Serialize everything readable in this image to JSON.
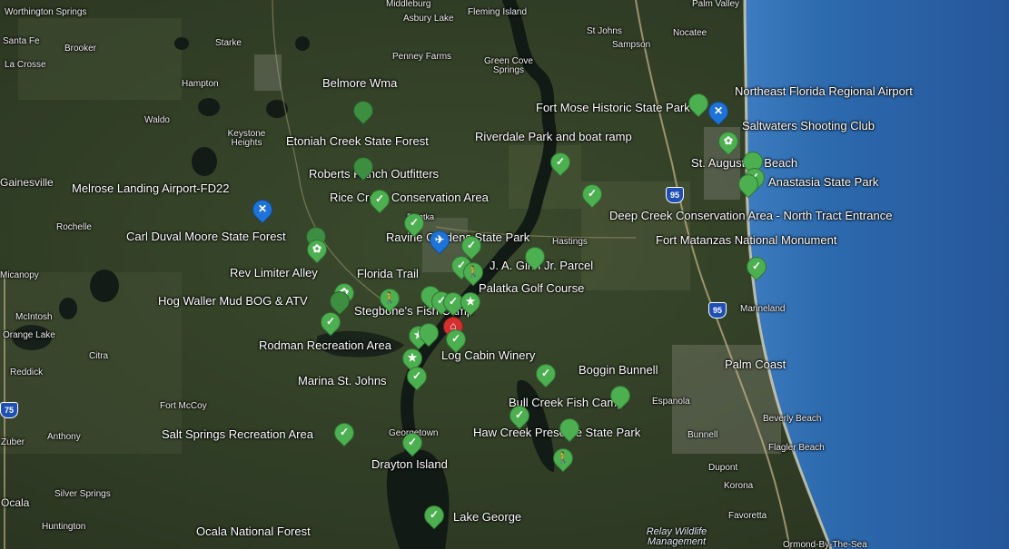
{
  "map_style": {
    "ocean_color": "#2a64a8",
    "land_color": "#34402a",
    "pin_green": "#4caf50",
    "pin_blue": "#1e73d8",
    "pin_red": "#d32f2f"
  },
  "places": [
    {
      "name": "Belmore Wma",
      "kind": "poi"
    },
    {
      "name": "Etoniah Creek State Forest",
      "kind": "poi"
    },
    {
      "name": "Roberts Ranch Outfitters",
      "kind": "poi"
    },
    {
      "name": "Melrose Landing Airport-FD22",
      "kind": "poi"
    },
    {
      "name": "Rice Creek Conservation Area",
      "kind": "poi"
    },
    {
      "name": "Carl Duval Moore State Forest",
      "kind": "poi"
    },
    {
      "name": "Ravine Gardens State Park",
      "kind": "poi"
    },
    {
      "name": "Rev Limiter Alley",
      "kind": "poi"
    },
    {
      "name": "Florida Trail",
      "kind": "poi"
    },
    {
      "name": "J. A. Ginn Jr. Parcel",
      "kind": "poi"
    },
    {
      "name": "Hog Waller Mud BOG & ATV",
      "kind": "poi"
    },
    {
      "name": "Palatka Golf Course",
      "kind": "poi"
    },
    {
      "name": "Stegbone's Fish Camp",
      "kind": "poi"
    },
    {
      "name": "Rodman Recreation Area",
      "kind": "poi"
    },
    {
      "name": "Log Cabin Winery",
      "kind": "poi"
    },
    {
      "name": "Marina St. Johns",
      "kind": "poi"
    },
    {
      "name": "Boggin Bunnell",
      "kind": "poi"
    },
    {
      "name": "Bull Creek Fish Camp",
      "kind": "poi"
    },
    {
      "name": "Salt Springs Recreation Area",
      "kind": "poi"
    },
    {
      "name": "Haw Creek Preserve State Park",
      "kind": "poi"
    },
    {
      "name": "Drayton Island",
      "kind": "poi"
    },
    {
      "name": "Lake George",
      "kind": "poi"
    },
    {
      "name": "Ocala National Forest",
      "kind": "poi"
    },
    {
      "name": "Riverdale Park and boat ramp",
      "kind": "poi"
    },
    {
      "name": "Fort Mose Historic State Park",
      "kind": "poi"
    },
    {
      "name": "Northeast Florida Regional Airport",
      "kind": "poi"
    },
    {
      "name": "Saltwaters Shooting Club",
      "kind": "poi"
    },
    {
      "name": "St. Augustine Beach",
      "kind": "poi"
    },
    {
      "name": "Anastasia State Park",
      "kind": "poi"
    },
    {
      "name": "Deep Creek Conservation Area - North Tract Entrance",
      "kind": "poi"
    },
    {
      "name": "Fort Matanzas National Monument",
      "kind": "poi"
    },
    {
      "name": "Palm Coast",
      "kind": "poi"
    },
    {
      "name": "Worthington Springs",
      "kind": "town"
    },
    {
      "name": "Santa Fe",
      "kind": "town"
    },
    {
      "name": "La Crosse",
      "kind": "town"
    },
    {
      "name": "Brooker",
      "kind": "town"
    },
    {
      "name": "Hampton",
      "kind": "town"
    },
    {
      "name": "Starke",
      "kind": "town"
    },
    {
      "name": "Waldo",
      "kind": "town"
    },
    {
      "name": "Keystone Heights",
      "kind": "town"
    },
    {
      "name": "Gainesville",
      "kind": "town"
    },
    {
      "name": "Rochelle",
      "kind": "town"
    },
    {
      "name": "Micanopy",
      "kind": "town"
    },
    {
      "name": "McIntosh",
      "kind": "town"
    },
    {
      "name": "Orange Lake",
      "kind": "town"
    },
    {
      "name": "Reddick",
      "kind": "town"
    },
    {
      "name": "Citra",
      "kind": "town"
    },
    {
      "name": "Fort McCoy",
      "kind": "town"
    },
    {
      "name": "Anthony",
      "kind": "town"
    },
    {
      "name": "Silver Springs",
      "kind": "town"
    },
    {
      "name": "Zuber",
      "kind": "town"
    },
    {
      "name": "Ocala",
      "kind": "town"
    },
    {
      "name": "Huntington",
      "kind": "town"
    },
    {
      "name": "Middleburg",
      "kind": "town"
    },
    {
      "name": "Asbury Lake",
      "kind": "town"
    },
    {
      "name": "Fleming Island",
      "kind": "town"
    },
    {
      "name": "Penney Farms",
      "kind": "town"
    },
    {
      "name": "Green Cove Springs",
      "kind": "town"
    },
    {
      "name": "St Johns",
      "kind": "town"
    },
    {
      "name": "Sampson",
      "kind": "town"
    },
    {
      "name": "Nocatee",
      "kind": "town"
    },
    {
      "name": "Palm Valley",
      "kind": "town"
    },
    {
      "name": "Hastings",
      "kind": "town"
    },
    {
      "name": "Espanola",
      "kind": "town"
    },
    {
      "name": "Bunnell",
      "kind": "town"
    },
    {
      "name": "Marineland",
      "kind": "town"
    },
    {
      "name": "Beverly Beach",
      "kind": "town"
    },
    {
      "name": "Flagler Beach",
      "kind": "town"
    },
    {
      "name": "Dupont",
      "kind": "town"
    },
    {
      "name": "Korona",
      "kind": "town"
    },
    {
      "name": "Favoretta",
      "kind": "town"
    },
    {
      "name": "Ormond-By-The-Sea",
      "kind": "town"
    },
    {
      "name": "Relay Wildlife Management",
      "kind": "water"
    },
    {
      "name": "Georgetown",
      "kind": "town"
    },
    {
      "name": "Palatka",
      "kind": "town"
    }
  ],
  "highway_shields": [
    "95",
    "95",
    "75"
  ]
}
